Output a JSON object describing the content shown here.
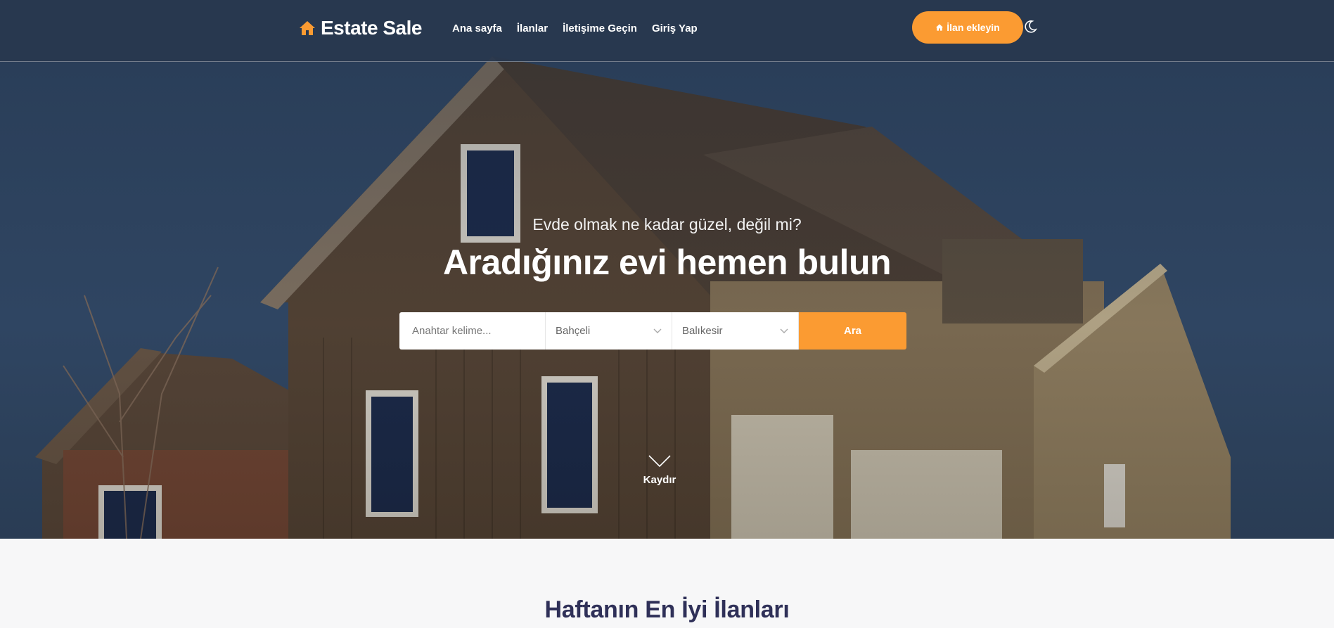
{
  "header": {
    "logo_text": "Estate Sale",
    "nav": [
      "Ana sayfa",
      "İlanlar",
      "İletişime Geçin",
      "Giriş Yap"
    ],
    "add_listing_label": "İlan ekleyin"
  },
  "hero": {
    "subtitle": "Evde olmak ne kadar güzel, değil mi?",
    "title": "Aradığınız evi hemen bulun"
  },
  "search": {
    "keyword_placeholder": "Anahtar kelime...",
    "type_selected": "Bahçeli",
    "city_selected": "Balıkesir",
    "button_label": "Ara"
  },
  "scroll": {
    "label": "Kaydır"
  },
  "section": {
    "title": "Haftanın En İyi İlanları"
  },
  "colors": {
    "accent": "#fb9b32",
    "header_bg": "#28374e",
    "section_title": "#2f3058"
  }
}
